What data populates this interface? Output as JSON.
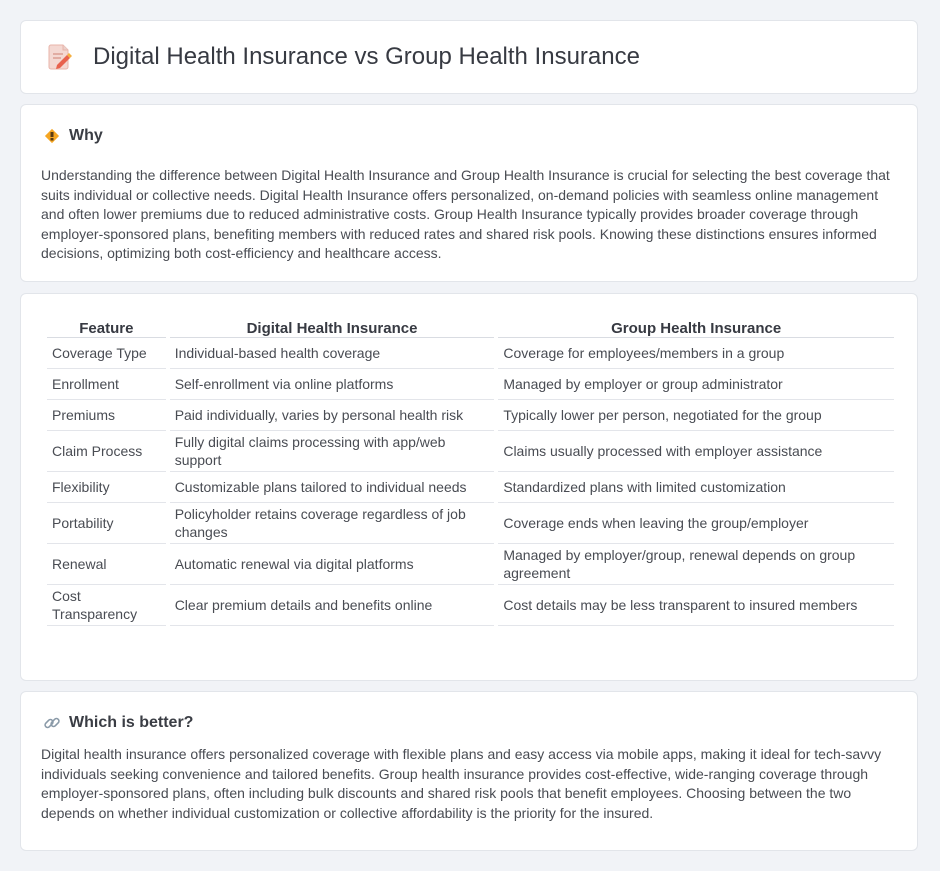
{
  "header": {
    "title": "Digital Health Insurance vs Group Health Insurance",
    "icon": "document-pencil-icon"
  },
  "why": {
    "heading": "Why",
    "icon": "warning-sign-icon",
    "text": "Understanding the difference between Digital Health Insurance and Group Health Insurance is crucial for selecting the best coverage that suits individual or collective needs. Digital Health Insurance offers personalized, on-demand policies with seamless online management and often lower premiums due to reduced administrative costs. Group Health Insurance typically provides broader coverage through employer-sponsored plans, benefiting members with reduced rates and shared risk pools. Knowing these distinctions ensures informed decisions, optimizing both cost-efficiency and healthcare access."
  },
  "table": {
    "headers": [
      "Feature",
      "Digital Health Insurance",
      "Group Health Insurance"
    ],
    "rows": [
      [
        "Coverage Type",
        "Individual-based health coverage",
        "Coverage for employees/members in a group"
      ],
      [
        "Enrollment",
        "Self-enrollment via online platforms",
        "Managed by employer or group administrator"
      ],
      [
        "Premiums",
        "Paid individually, varies by personal health risk",
        "Typically lower per person, negotiated for the group"
      ],
      [
        "Claim Process",
        "Fully digital claims processing with app/web support",
        "Claims usually processed with employer assistance"
      ],
      [
        "Flexibility",
        "Customizable plans tailored to individual needs",
        "Standardized plans with limited customization"
      ],
      [
        "Portability",
        "Policyholder retains coverage regardless of job changes",
        "Coverage ends when leaving the group/employer"
      ],
      [
        "Renewal",
        "Automatic renewal via digital platforms",
        "Managed by employer/group, renewal depends on group agreement"
      ],
      [
        "Cost Transparency",
        "Clear premium details and benefits online",
        "Cost details may be less transparent to insured members"
      ]
    ]
  },
  "better": {
    "heading": "Which is better?",
    "icon": "link-icon",
    "text": "Digital health insurance offers personalized coverage with flexible plans and easy access via mobile apps, making it ideal for tech-savvy individuals seeking convenience and tailored benefits. Group health insurance provides cost-effective, wide-ranging coverage through employer-sponsored plans, often including bulk discounts and shared risk pools that benefit employees. Choosing between the two depends on whether individual customization or collective affordability is the priority for the insured."
  }
}
